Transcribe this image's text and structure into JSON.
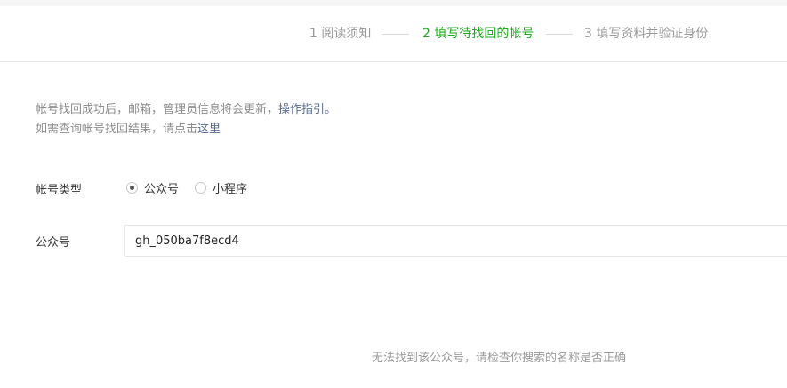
{
  "steps": {
    "step1": "1 阅读须知",
    "step2": "2 填写待找回的帐号",
    "step3": "3 填写资料并验证身份"
  },
  "notice": {
    "line1_text": "帐号找回成功后，邮箱，管理员信息将会更新，",
    "line1_link": "操作指引。",
    "line2_text": "如需查询帐号找回结果，请点击",
    "line2_link": "这里"
  },
  "form": {
    "account_type_label": "帐号类型",
    "options": [
      {
        "label": "公众号",
        "checked": true
      },
      {
        "label": "小程序",
        "checked": false
      }
    ],
    "account_label": "公众号",
    "account_value": "gh_050ba7f8ecd4"
  },
  "error_message": "无法找到该公众号，请检查你搜索的名称是否正确",
  "colors": {
    "active_step": "#1aad19",
    "link": "#576b95",
    "muted": "#9a9a9a"
  }
}
